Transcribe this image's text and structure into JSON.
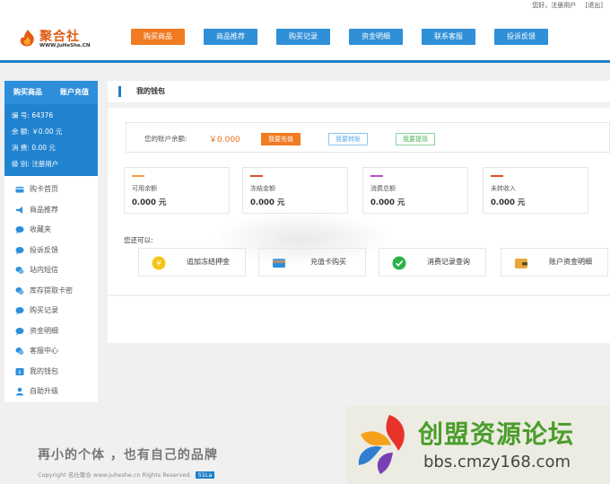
{
  "topbar": {
    "greeting": "您好，注册用户",
    "logout": "[退出]"
  },
  "logo": {
    "name": "聚合社",
    "url": "WWW.JuHeShe.CN"
  },
  "nav": [
    {
      "label": "购买商品",
      "active": true
    },
    {
      "label": "商品推荐",
      "active": false
    },
    {
      "label": "购买记录",
      "active": false
    },
    {
      "label": "资金明细",
      "active": false
    },
    {
      "label": "联系客服",
      "active": false
    },
    {
      "label": "投诉反馈",
      "active": false
    }
  ],
  "sidebar": {
    "tabs": [
      "购买商品",
      "账户充值"
    ],
    "info": [
      {
        "label": "编  号:",
        "value": "64376"
      },
      {
        "label": "余  额:",
        "value": "￥0.00 元"
      },
      {
        "label": "消  费:",
        "value": "0.00 元"
      },
      {
        "label": "级  别:",
        "value": "注册用户"
      }
    ],
    "menu": [
      {
        "label": "购卡首页",
        "icon": "card-icon"
      },
      {
        "label": "商品推荐",
        "icon": "megaphone-icon"
      },
      {
        "label": "收藏夹",
        "icon": "chat-bubble-icon"
      },
      {
        "label": "投诉反馈",
        "icon": "chat-bubble-icon"
      },
      {
        "label": "站内短信",
        "icon": "message-icon"
      },
      {
        "label": "库存提取卡密",
        "icon": "message-icon"
      },
      {
        "label": "购买记录",
        "icon": "chat-bubble-icon"
      },
      {
        "label": "资金明细",
        "icon": "chat-bubble-icon"
      },
      {
        "label": "客服中心",
        "icon": "message-icon"
      },
      {
        "label": "我的钱包",
        "icon": "wallet-icon"
      },
      {
        "label": "自助升级",
        "icon": "user-icon"
      }
    ]
  },
  "main": {
    "title": "我的钱包",
    "balance_label": "您的账户余额:",
    "balance_value": "￥0.000",
    "buttons": [
      "我要充值",
      "我要转账",
      "我要提现"
    ],
    "stats": [
      {
        "label": "可用余额",
        "value": "0.000 元",
        "color": "#f0a040"
      },
      {
        "label": "冻结金额",
        "value": "0.000 元",
        "color": "#d9531e"
      },
      {
        "label": "消费总额",
        "value": "0.000 元",
        "color": "#b84fc9"
      },
      {
        "label": "未转收入",
        "value": "0.000 元",
        "color": "#d9531e"
      }
    ],
    "can_label": "您还可以:",
    "actions": [
      {
        "label": "追加冻结押金",
        "icon": "coin-icon"
      },
      {
        "label": "充值卡购买",
        "icon": "card-icon"
      },
      {
        "label": "消费记录查询",
        "icon": "check-icon"
      },
      {
        "label": "账户资金明细",
        "icon": "wallet-icon"
      }
    ]
  },
  "footer": {
    "slogan": "再小的个体 ，也有自己的品牌",
    "copyright": "Copyright 名仕聚合 www.juheshe.cn Rights Reserved.",
    "badge": "51La"
  },
  "watermark": {
    "title": "创盟资源论坛",
    "url": "bbs.cmzy168.com"
  }
}
